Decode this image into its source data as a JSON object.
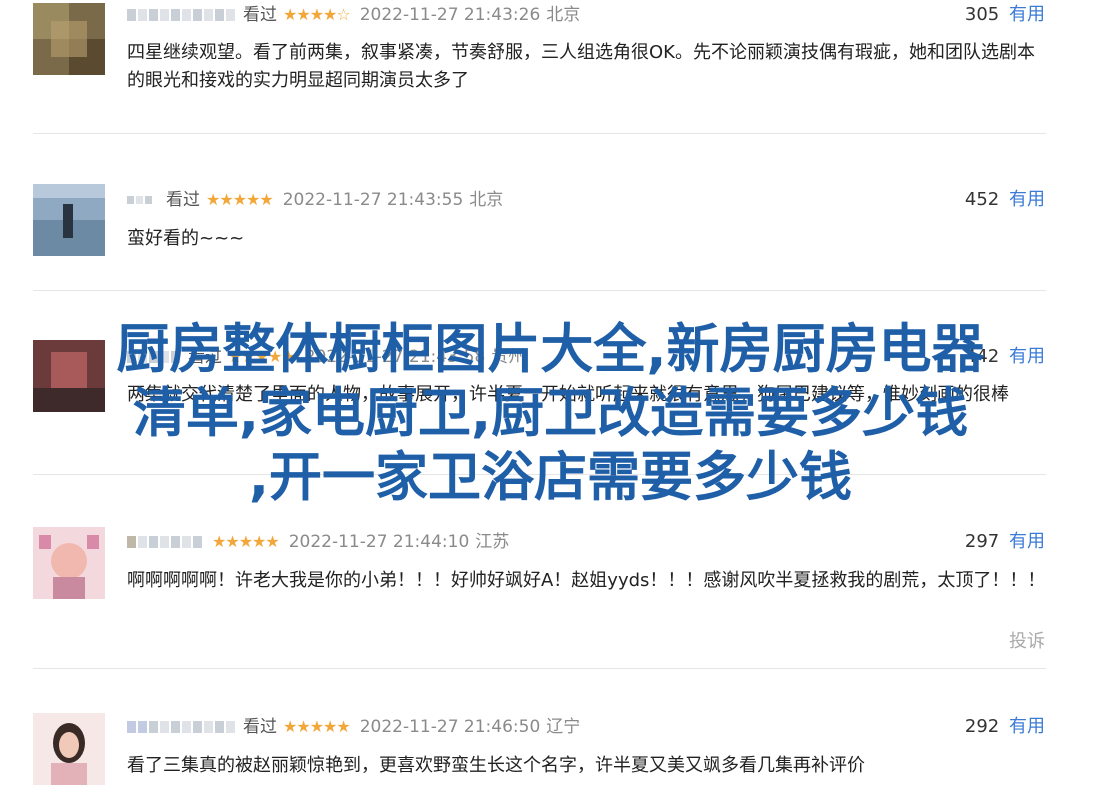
{
  "reviews": [
    {
      "watched": "看过",
      "stars": "★★★★☆",
      "time": "2022-11-27 21:43:26",
      "location": "北京",
      "votes": "305",
      "useful": "有用",
      "content": "四星继续观望。看了前两集，叙事紧凑，节奏舒服，三人组选角很OK。先不论丽颖演技偶有瑕疵，她和团队选剧本的眼光和接戏的实力明显超同期演员太多了"
    },
    {
      "watched": "看过",
      "stars": "★★★★★",
      "time": "2022-11-27 21:43:55",
      "location": "北京",
      "votes": "452",
      "useful": "有用",
      "content": "蛮好看的~~~"
    },
    {
      "watched": "看过",
      "stars": "★★★★★",
      "time": "2022-11-27 21:43:58",
      "location": "贵州",
      "votes": "442",
      "useful": "有用",
      "content": "两集就交代清楚了里面的人物，故事展开，许半夏一开始就听起来就很有意思，狗尾巴建议等，惟妙刻画的很棒"
    },
    {
      "watched": "",
      "stars": "★★★★★",
      "time": "2022-11-27 21:44:10",
      "location": "江苏",
      "votes": "297",
      "useful": "有用",
      "content": "啊啊啊啊啊！许老大我是你的小弟！！！好帅好飒好A！赵姐yyds！！！感谢风吹半夏拯救我的剧荒，太顶了！！！",
      "report": "投诉"
    },
    {
      "watched": "看过",
      "stars": "★★★★★",
      "time": "2022-11-27 21:46:50",
      "location": "辽宁",
      "votes": "292",
      "useful": "有用",
      "content": "看了三集真的被赵丽颖惊艳到，更喜欢野蛮生长这个名字，许半夏又美又飒多看几集再补评价"
    }
  ],
  "overlay_title": {
    "line1": "厨房整体橱柜图片大全,新房厨房电器",
    "line2": "清单,家电厨卫,厨卫改造需要多少钱",
    "line3": ",开一家卫浴店需要多少钱"
  },
  "colors": {
    "accent": "#3a7bd5",
    "stars": "#f2a73b",
    "overlay": "#1f5fa8"
  }
}
